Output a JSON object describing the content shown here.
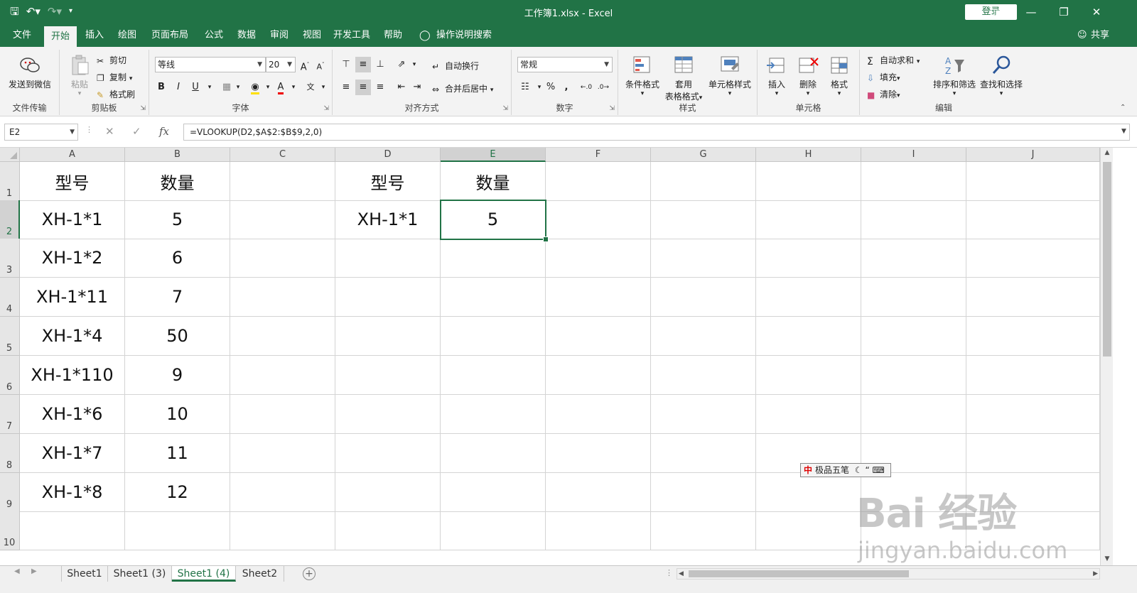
{
  "title_bar": {
    "title": "工作簿1.xlsx  -  Excel",
    "login_label": "登录",
    "qat": {
      "save_icon": "save-icon",
      "undo_icon": "undo-icon",
      "redo_icon": "redo-icon",
      "customize_icon": "customize-icon"
    }
  },
  "tabs": [
    {
      "label": "文件"
    },
    {
      "label": "开始"
    },
    {
      "label": "插入"
    },
    {
      "label": "绘图"
    },
    {
      "label": "页面布局"
    },
    {
      "label": "公式"
    },
    {
      "label": "数据"
    },
    {
      "label": "审阅"
    },
    {
      "label": "视图"
    },
    {
      "label": "开发工具"
    },
    {
      "label": "帮助"
    }
  ],
  "tell_me": "操作说明搜索",
  "share": "共享",
  "ribbon": {
    "file_transfer": {
      "send_wechat": "发送到微信",
      "label": "文件传输"
    },
    "clipboard": {
      "paste": "粘贴",
      "cut": "剪切",
      "copy": "复制",
      "format_painter": "格式刷",
      "label": "剪贴板"
    },
    "font": {
      "font_name": "等线",
      "font_size": "20",
      "bold": "B",
      "italic": "I",
      "underline": "U",
      "label": "字体"
    },
    "alignment": {
      "wrap": "自动换行",
      "merge": "合并后居中",
      "label": "对齐方式"
    },
    "number": {
      "format": "常规",
      "percent": "%",
      "comma": ",",
      "label": "数字"
    },
    "styles": {
      "conditional": "条件格式",
      "table_line1": "套用",
      "table_line2": "表格格式",
      "cell_styles": "单元格样式",
      "label": "样式"
    },
    "cells": {
      "insert": "插入",
      "delete": "删除",
      "format": "格式",
      "label": "单元格"
    },
    "editing": {
      "autosum": "自动求和",
      "fill": "填充",
      "clear": "清除",
      "sort": "排序和筛选",
      "find": "查找和选择",
      "label": "编辑"
    }
  },
  "formula_bar": {
    "name_box": "E2",
    "formula": "=VLOOKUP(D2,$A$2:$B$9,2,0)"
  },
  "columns": [
    "A",
    "B",
    "C",
    "D",
    "E",
    "F",
    "G",
    "H",
    "I",
    "J"
  ],
  "rows": [
    "1",
    "2",
    "3",
    "4",
    "5",
    "6",
    "7",
    "8",
    "9",
    "10"
  ],
  "cells": {
    "A1": "型号",
    "B1": "数量",
    "D1": "型号",
    "E1": "数量",
    "A2": "XH-1*1",
    "B2": "5",
    "D2": "XH-1*1",
    "E2": "5",
    "A3": "XH-1*2",
    "B3": "6",
    "A4": "XH-1*11",
    "B4": "7",
    "A5": "XH-1*4",
    "B5": "50",
    "A6": "XH-1*110",
    "B6": "9",
    "A7": "XH-1*6",
    "B7": "10",
    "A8": "XH-1*7",
    "B8": "11",
    "A9": "XH-1*8",
    "B9": "12"
  },
  "ime": {
    "mode": "中",
    "name": "极品五笔"
  },
  "watermark": {
    "brand": "Bai 经验",
    "url": "jingyan.baidu.com"
  },
  "sheets": [
    {
      "label": "Sheet1"
    },
    {
      "label": "Sheet1 (3)"
    },
    {
      "label": "Sheet1 (4)"
    },
    {
      "label": "Sheet2"
    }
  ],
  "colors": {
    "accent": "#217346",
    "ribbon_bg": "#f3f3f3",
    "grid_line": "#d4d4d4"
  }
}
